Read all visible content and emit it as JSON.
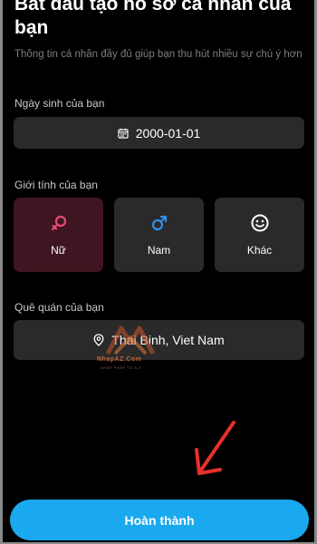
{
  "header": {
    "title": "Bắt đầu tạo hồ sơ cá nhân của bạn",
    "subtitle": "Thông tin cá nhân đầy đủ giúp bạn thu hút nhiều sự chú ý hơn"
  },
  "birthday": {
    "label": "Ngày sinh của bạn",
    "value": "2000-01-01",
    "icon": "calendar-icon"
  },
  "gender": {
    "label": "Giới tính của bạn",
    "selected": "Nữ",
    "options": [
      {
        "label": "Nữ",
        "icon": "female-icon",
        "color": "#e84a73"
      },
      {
        "label": "Nam",
        "icon": "male-icon",
        "color": "#2f8fe8"
      },
      {
        "label": "Khác",
        "icon": "smiley-icon",
        "color": "#ffffff"
      }
    ]
  },
  "hometown": {
    "label": "Quê quán của bạn",
    "value": "Thai Binh, Viet Nam",
    "icon": "location-pin-icon"
  },
  "watermark": {
    "text": "NhapAZ.Com",
    "sub": "NHẬP PHÁP TỪ A-Z"
  },
  "finish_button": {
    "label": "Hoàn thành",
    "color": "#1aa9ee"
  },
  "annotation": {
    "icon": "red-arrow-icon",
    "color": "#e8302a"
  }
}
